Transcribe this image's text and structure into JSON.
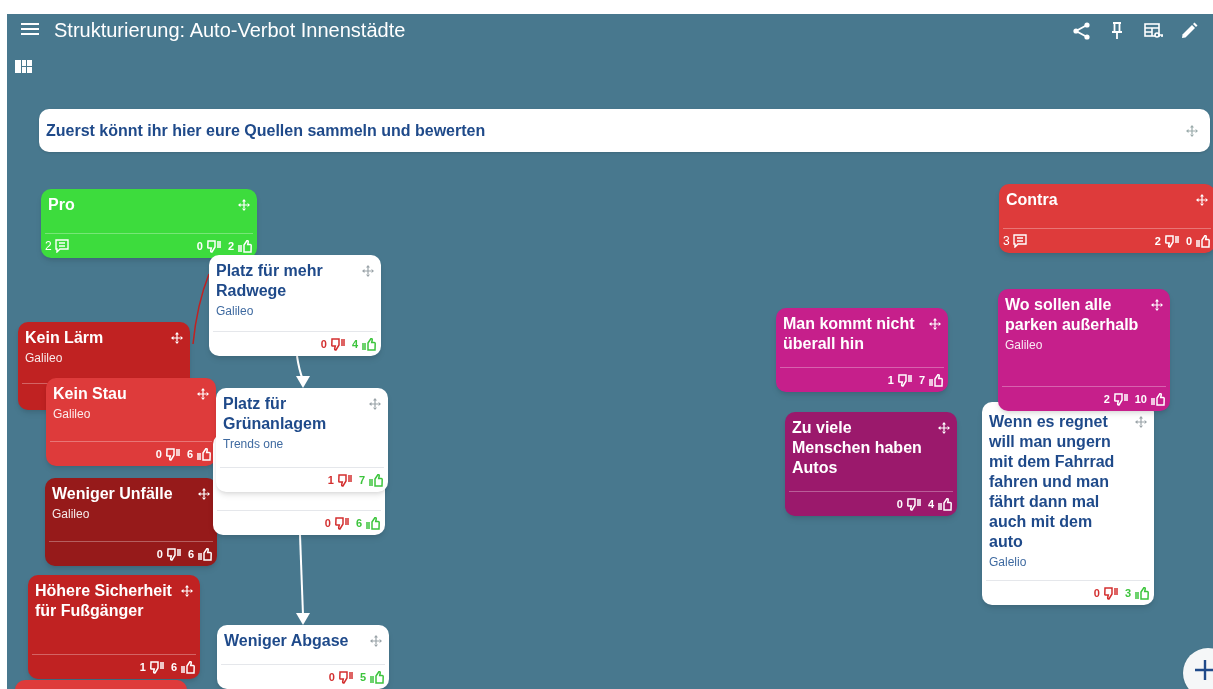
{
  "title": "Strukturierung: Auto-Verbot Innenstädte",
  "intro": "Zuerst könnt ihr hier eure Quellen sammeln und bewerten",
  "cards": [
    {
      "title": "Pro",
      "color": "#3ddc3d",
      "comments": "2",
      "down": "0",
      "up": "2"
    },
    {
      "title": "Contra",
      "color": "#de3b3b",
      "comments": "3",
      "down": "2",
      "up": "0"
    },
    {
      "title": "Platz für mehr Radwege",
      "source": "Galileo",
      "color": "#ffffff",
      "down": "0",
      "up": "4"
    },
    {
      "title": "Kein Lärm",
      "source": "Galileo",
      "color": "#c02222"
    },
    {
      "title": "Kein Stau",
      "source": "Galileo",
      "color": "#de3b3b",
      "down": "0",
      "up": "6"
    },
    {
      "title": "Platz für Grünanlagem",
      "source": "Trends one",
      "color": "#ffffff",
      "down": "1",
      "up": "7"
    },
    {
      "color": "#ffffff",
      "down": "0",
      "up": "6"
    },
    {
      "title": "Weniger Unfälle",
      "source": "Galileo",
      "color": "#961a1a",
      "down": "0",
      "up": "6"
    },
    {
      "title": "Höhere Sicherheit für Fußgänger",
      "color": "#c02222",
      "down": "1",
      "up": "6"
    },
    {
      "color": "#de3b3b"
    },
    {
      "title": "Weniger Abgase",
      "color": "#ffffff",
      "down": "0",
      "up": "5"
    },
    {
      "title": "Man kommt nicht überall hin",
      "color": "#c61f8b",
      "down": "1",
      "up": "7"
    },
    {
      "title": "Zu viele Menschen haben Autos",
      "color": "#9b196c",
      "down": "0",
      "up": "4"
    },
    {
      "title": "Wo sollen alle parken außerhalb",
      "source": "Galileo",
      "color": "#c61f8b",
      "down": "2",
      "up": "10"
    },
    {
      "title": "Wenn es regnet will man ungern mit dem Fahrrad fahren und man fährt dann mal auch mit dem auto",
      "source": "Galelio",
      "color": "#ffffff",
      "down": "0",
      "up": "3"
    }
  ]
}
